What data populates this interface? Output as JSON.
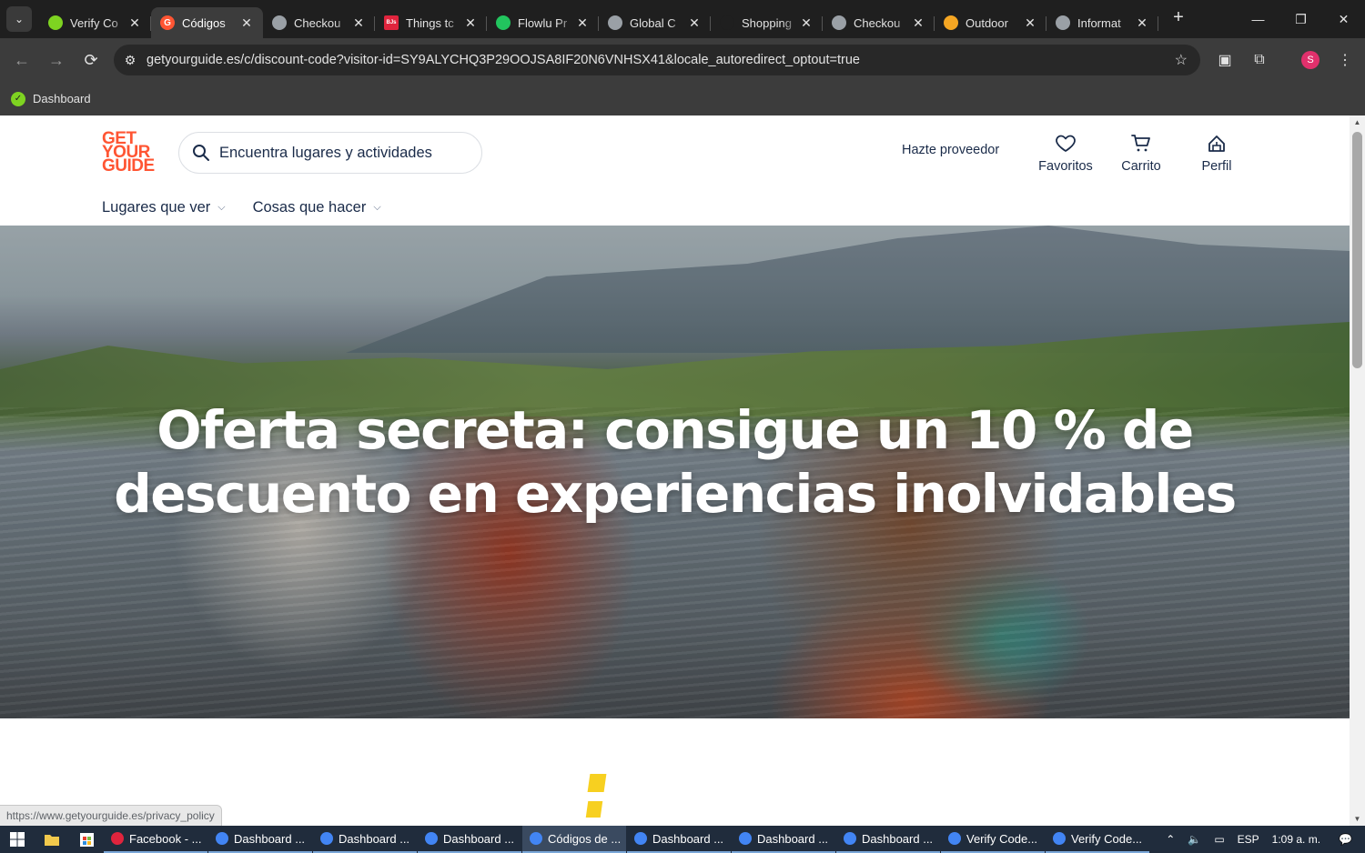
{
  "browser": {
    "tabs": [
      {
        "title": "Verify Co",
        "favicon_color": "#7ed321",
        "active": false
      },
      {
        "title": "Códigos",
        "favicon_color": "#ff5533",
        "active": true
      },
      {
        "title": "Checkou",
        "favicon_color": "#9aa0a6",
        "active": false
      },
      {
        "title": "Things tc",
        "favicon_color": "#e0243d",
        "active": false
      },
      {
        "title": "Flowlu Pr",
        "favicon_color": "#22c55e",
        "active": false
      },
      {
        "title": "Global C",
        "favicon_color": "#9aa0a6",
        "active": false
      },
      {
        "title": "Shopping",
        "favicon_color": "#1f1f1f",
        "active": false
      },
      {
        "title": "Checkou",
        "favicon_color": "#9aa0a6",
        "active": false
      },
      {
        "title": "Outdoor",
        "favicon_color": "#f5a623",
        "active": false
      },
      {
        "title": "Informat",
        "favicon_color": "#9aa0a6",
        "active": false
      }
    ],
    "favicon_letters": {
      "codigos": "G",
      "things": "BJs"
    },
    "url": "getyourguide.es/c/discount-code?visitor-id=SY9ALYCHQ3P29OOJSA8IF20N6VNHSX41&locale_autoredirect_optout=true",
    "profile_initial": "S",
    "bookmark": "Dashboard"
  },
  "site": {
    "logo_lines": [
      "GET",
      "YOUR",
      "GUIDE"
    ],
    "brand_color": "#ff5533",
    "search_placeholder": "Encuentra lugares y actividades",
    "provider_link": "Hazte proveedor",
    "nav_icons": {
      "favorites": "Favoritos",
      "cart": "Carrito",
      "profile": "Perfil"
    },
    "categories": [
      "Lugares que ver",
      "Cosas que hacer"
    ],
    "hero_title": "Oferta secreta: consigue un 10 % de descuento en experiencias inolvidables"
  },
  "status_bar_url": "https://www.getyourguide.es/privacy_policy",
  "taskbar": {
    "items": [
      {
        "label": "Facebook - ...",
        "color": "#e0243d"
      },
      {
        "label": "Dashboard ...",
        "color": "#4285f4"
      },
      {
        "label": "Dashboard ...",
        "color": "#4285f4"
      },
      {
        "label": "Dashboard ...",
        "color": "#4285f4"
      },
      {
        "label": "Códigos de ...",
        "color": "#4285f4"
      },
      {
        "label": "Dashboard ...",
        "color": "#4285f4"
      },
      {
        "label": "Dashboard ...",
        "color": "#4285f4"
      },
      {
        "label": "Dashboard ...",
        "color": "#4285f4"
      },
      {
        "label": "Verify Code...",
        "color": "#4285f4"
      },
      {
        "label": "Verify Code...",
        "color": "#4285f4"
      }
    ],
    "active_index": 4,
    "language": "ESP",
    "time": "1:09 a. m."
  }
}
